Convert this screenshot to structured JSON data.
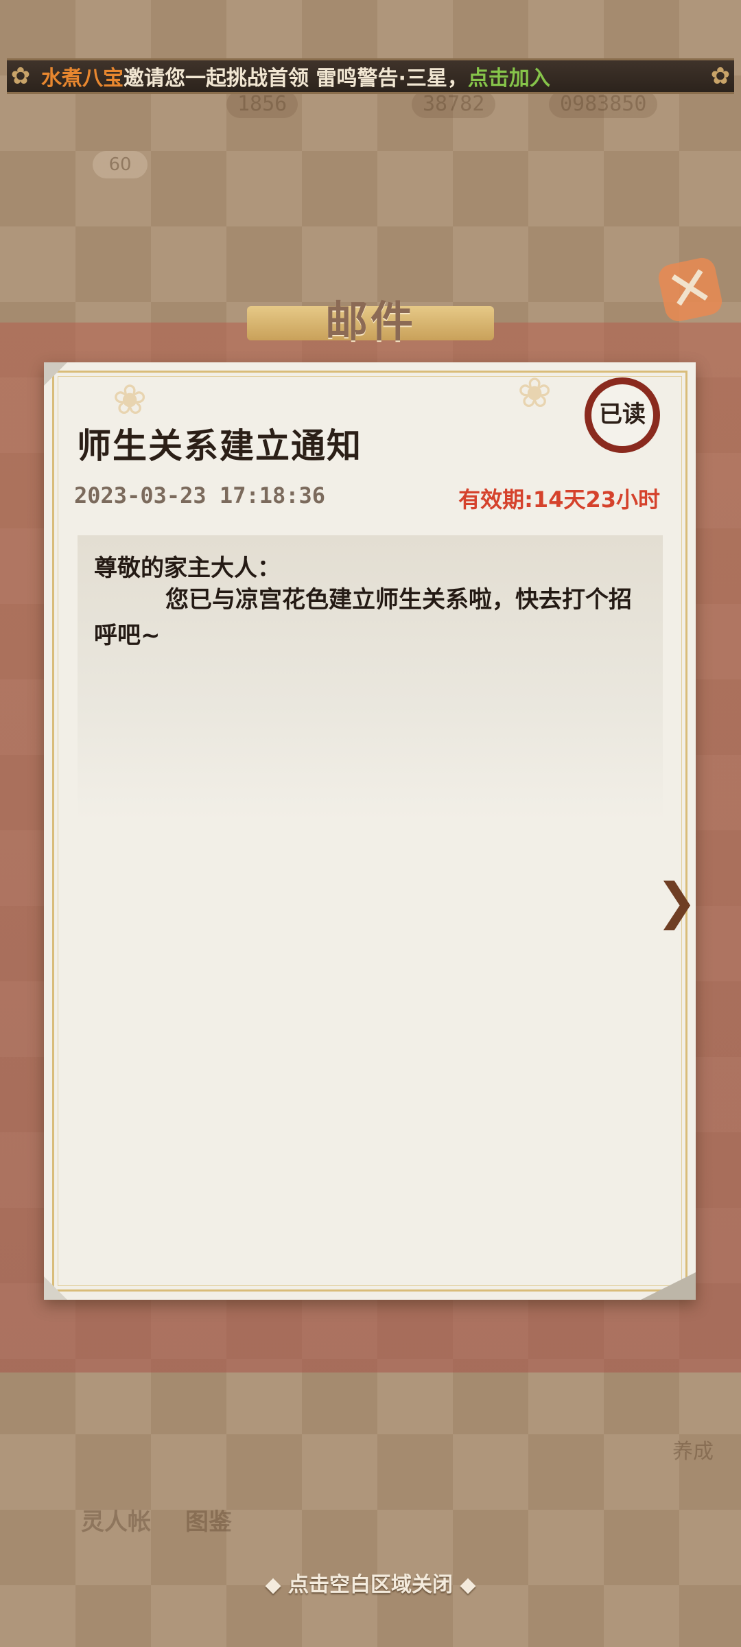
{
  "marquee": {
    "icon_left": "sakura-icon",
    "player_name": "水煮八宝",
    "message": "邀请您一起挑战首领 雷鸣警告·三星，",
    "action": "点击加入",
    "icon_right": "sakura-icon"
  },
  "background": {
    "resource_1": "1856",
    "resource_2": "38782",
    "resource_3": "0983850",
    "level": "60",
    "tab_1": "灵人帐",
    "tab_2": "图鉴",
    "side_label": "养成"
  },
  "dialog": {
    "title": "邮件",
    "close_icon": "close-icon"
  },
  "mail": {
    "subject": "师生关系建立通知",
    "status": "已读",
    "date": "2023-03-23  17:18:36",
    "expiry": "有效期:14天23小时",
    "greeting": "尊敬的家主大人：",
    "content": "您已与凉宫花色建立师生关系啦，快去打个招呼吧~",
    "next_icon": "next-arrow-icon"
  },
  "footer": {
    "close_hint": "◆ 点击空白区域关闭 ◆"
  },
  "colors": {
    "accent_red": "#d5422c",
    "player_orange": "#e8872f",
    "join_green": "#86c44a",
    "paper": "#f2efe7",
    "gold_border": "#d9bc79"
  }
}
